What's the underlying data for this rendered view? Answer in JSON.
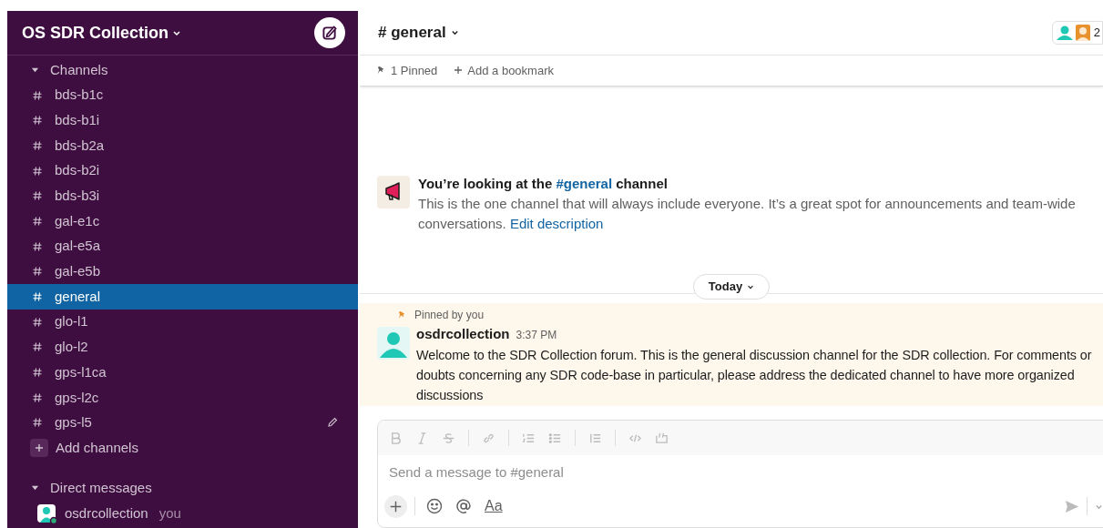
{
  "workspace": {
    "name": "OS SDR Collection"
  },
  "sidebar": {
    "channels_header": "Channels",
    "channels_expanded": true,
    "channels": [
      {
        "name": "bds-b1c",
        "selected": false,
        "hovered": false
      },
      {
        "name": "bds-b1i",
        "selected": false,
        "hovered": false
      },
      {
        "name": "bds-b2a",
        "selected": false,
        "hovered": false
      },
      {
        "name": "bds-b2i",
        "selected": false,
        "hovered": false
      },
      {
        "name": "bds-b3i",
        "selected": false,
        "hovered": false
      },
      {
        "name": "gal-e1c",
        "selected": false,
        "hovered": false
      },
      {
        "name": "gal-e5a",
        "selected": false,
        "hovered": false
      },
      {
        "name": "gal-e5b",
        "selected": false,
        "hovered": false
      },
      {
        "name": "general",
        "selected": true,
        "hovered": false
      },
      {
        "name": "glo-l1",
        "selected": false,
        "hovered": false
      },
      {
        "name": "glo-l2",
        "selected": false,
        "hovered": false
      },
      {
        "name": "gps-l1ca",
        "selected": false,
        "hovered": false
      },
      {
        "name": "gps-l2c",
        "selected": false,
        "hovered": false
      },
      {
        "name": "gps-l5",
        "selected": false,
        "hovered": true
      }
    ],
    "add_channels": "Add channels",
    "dm_header": "Direct messages",
    "dm_expanded": true,
    "direct_messages": [
      {
        "name": "osdrcollection",
        "note": "you",
        "online": true
      }
    ]
  },
  "channel": {
    "title": "# general",
    "member_count": "2",
    "pinned": "1 Pinned",
    "add_bookmark": "Add a bookmark"
  },
  "intro": {
    "title_before": "You’re looking at the ",
    "title_link": "#general",
    "title_after": " channel",
    "description": "This is the one channel that will always include everyone. It’s a great spot for announcements and team-wide conversations.",
    "edit_link": "Edit description"
  },
  "divider": {
    "label": "Today"
  },
  "messages": [
    {
      "pinned_note": "Pinned by you",
      "author": "osdrcollection",
      "time": "3:37 PM",
      "text": "Welcome to the SDR Collection forum. This is the general discussion channel for the SDR collection. For comments or doubts concerning any SDR code-base in particular, please address the dedicated channel to have more organized discussions"
    }
  ],
  "composer": {
    "placeholder": "Send a message to #general",
    "format_label": "Aa"
  }
}
